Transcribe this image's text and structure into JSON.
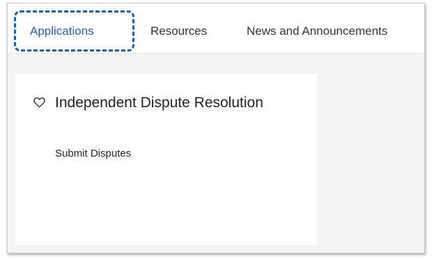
{
  "tabs": {
    "applications": "Applications",
    "resources": "Resources",
    "news": "News and Announcements"
  },
  "card": {
    "title": "Independent Dispute Resolution",
    "link": "Submit Disputes",
    "favorite_icon": "heart-outline-icon"
  },
  "colors": {
    "active_tab": "#2a5d9f",
    "focus_ring": "#1e5f99",
    "panel_bg": "#f3f3f3"
  }
}
